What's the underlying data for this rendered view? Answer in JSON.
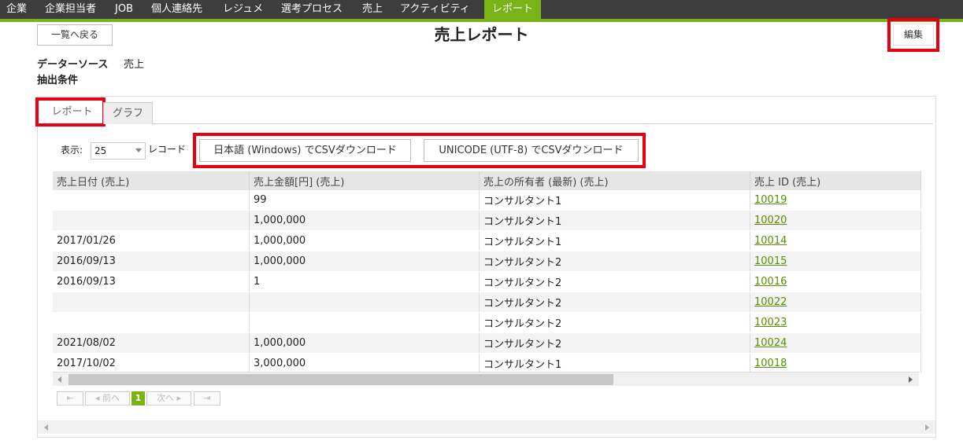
{
  "nav": {
    "items": [
      "企業",
      "企業担当者",
      "JOB",
      "個人連絡先",
      "レジュメ",
      "選考プロセス",
      "売上",
      "アクティビティ"
    ],
    "active": "レポート"
  },
  "header": {
    "back_label": "一覧へ戻る",
    "title": "売上レポート",
    "edit_label": "編集"
  },
  "meta": {
    "datasource_label": "データーソース",
    "datasource_value": "売上",
    "conditions_label": "抽出条件"
  },
  "tabs": {
    "report": "レポート",
    "graph": "グラフ"
  },
  "toolbar": {
    "show_label": "表示:",
    "page_size": "25",
    "records_label": "レコード",
    "csv_sjis_label": "日本語 (Windows) でCSVダウンロード",
    "csv_utf8_label": "UNICODE (UTF-8) でCSVダウンロード"
  },
  "table": {
    "headers": [
      "売上日付 (売上)",
      "売上金額[円] (売上)",
      "売上の所有者 (最新) (売上)",
      "売上 ID (売上)"
    ],
    "rows": [
      [
        "",
        "99",
        "コンサルタント1",
        "10019"
      ],
      [
        "",
        "1,000,000",
        "コンサルタント1",
        "10020"
      ],
      [
        "2017/01/26",
        "1,000,000",
        "コンサルタント1",
        "10014"
      ],
      [
        "2016/09/13",
        "1,000,000",
        "コンサルタント2",
        "10015"
      ],
      [
        "2016/09/13",
        "1",
        "コンサルタント2",
        "10016"
      ],
      [
        "",
        "",
        "コンサルタント2",
        "10022"
      ],
      [
        "",
        "",
        "コンサルタント2",
        "10023"
      ],
      [
        "2021/08/02",
        "1,000,000",
        "コンサルタント2",
        "10024"
      ],
      [
        "2017/10/02",
        "3,000,000",
        "コンサルタント1",
        "10018"
      ]
    ]
  },
  "pager": {
    "first": "⇤",
    "prev": "◂ 前へ",
    "current": "1",
    "next": "次へ ▸",
    "last": "⇥"
  },
  "colors": {
    "accent": "#7ab317",
    "nav_bg": "#3d3d3d",
    "highlight": "#e60012",
    "link": "#5a8e00"
  }
}
